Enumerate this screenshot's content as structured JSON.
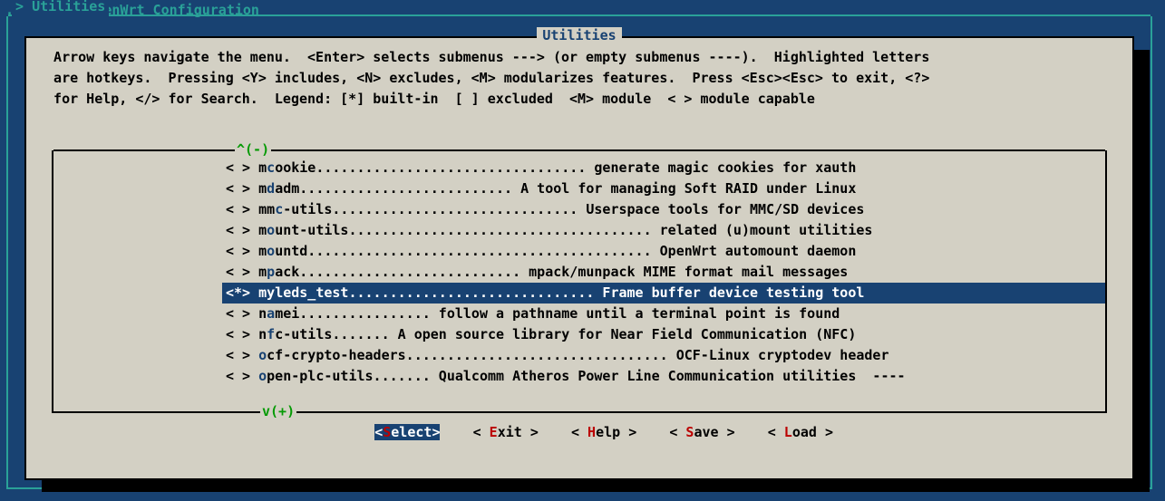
{
  "header": {
    "line1": ".config - OpenWrt Configuration",
    "breadcrumb_prefix": "> ",
    "breadcrumb": "Utilities"
  },
  "dialog": {
    "title": "Utilities",
    "help": "  Arrow keys navigate the menu.  <Enter> selects submenus ---> (or empty submenus ----).  Highlighted letters\n  are hotkeys.  Pressing <Y> includes, <N> excludes, <M> modularizes features.  Press <Esc><Esc> to exit, <?>\n  for Help, </> for Search.  Legend: [*] built-in  [ ] excluded  <M> module  < > module capable",
    "scroll_up": "^(-)",
    "scroll_down": "v(+)"
  },
  "items": [
    {
      "mark": "< >",
      "pre": "m",
      "hot": "c",
      "post": "ookie",
      "dots": ".................................",
      "desc": " generate magic cookies for xauth",
      "selected": false,
      "trail": ""
    },
    {
      "mark": "< >",
      "pre": "m",
      "hot": "d",
      "post": "adm",
      "dots": "..........................",
      "desc": " A tool for managing Soft RAID under Linux",
      "selected": false,
      "trail": ""
    },
    {
      "mark": "< >",
      "pre": "mm",
      "hot": "c",
      "post": "-utils",
      "dots": "..............................",
      "desc": " Userspace tools for MMC/SD devices",
      "selected": false,
      "trail": ""
    },
    {
      "mark": "< >",
      "pre": "m",
      "hot": "o",
      "post": "unt-utils",
      "dots": ".....................................",
      "desc": " related (u)mount utilities",
      "selected": false,
      "trail": ""
    },
    {
      "mark": "< >",
      "pre": "m",
      "hot": "o",
      "post": "untd",
      "dots": "..........................................",
      "desc": " OpenWrt automount daemon",
      "selected": false,
      "trail": ""
    },
    {
      "mark": "< >",
      "pre": "m",
      "hot": "p",
      "post": "ack",
      "dots": "...........................",
      "desc": " mpack/munpack MIME format mail messages",
      "selected": false,
      "trail": ""
    },
    {
      "mark": "<*>",
      "pre": "my",
      "hot": "l",
      "post": "eds_test",
      "dots": "..............................",
      "desc": " Frame buffer device testing tool",
      "selected": true,
      "trail": ""
    },
    {
      "mark": "< >",
      "pre": "n",
      "hot": "a",
      "post": "mei",
      "dots": "................",
      "desc": " follow a pathname until a terminal point is found",
      "selected": false,
      "trail": ""
    },
    {
      "mark": "< >",
      "pre": "n",
      "hot": "f",
      "post": "c-utils",
      "dots": ".......",
      "desc": " A open source library for Near Field Communication (NFC)",
      "selected": false,
      "trail": ""
    },
    {
      "mark": "< >",
      "pre": "",
      "hot": "o",
      "post": "cf-crypto-headers",
      "dots": "................................",
      "desc": " OCF-Linux cryptodev header",
      "selected": false,
      "trail": ""
    },
    {
      "mark": "< >",
      "pre": "",
      "hot": "o",
      "post": "pen-plc-utils",
      "dots": ".......",
      "desc": " Qualcomm Atheros Power Line Communication utilities",
      "selected": false,
      "trail": "  ----"
    }
  ],
  "buttons": {
    "select": {
      "open": "<",
      "hot": "S",
      "rest": "elect",
      "close": ">",
      "selected": true
    },
    "exit": {
      "open": "< ",
      "hot": "E",
      "rest": "xit ",
      "close": ">",
      "selected": false
    },
    "help": {
      "open": "< ",
      "hot": "H",
      "rest": "elp ",
      "close": ">",
      "selected": false
    },
    "save": {
      "open": "< ",
      "hot": "S",
      "rest": "ave ",
      "close": ">",
      "selected": false
    },
    "load": {
      "open": "< ",
      "hot": "L",
      "rest": "oad ",
      "close": ">",
      "selected": false
    },
    "gap": "    "
  }
}
